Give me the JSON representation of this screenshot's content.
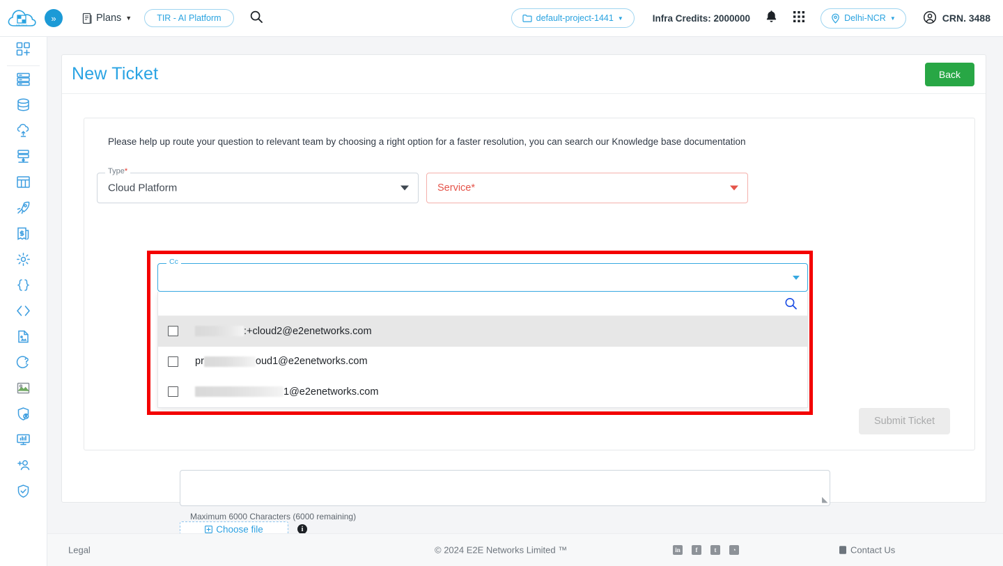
{
  "header": {
    "logo_alt": "E2E Cloud",
    "expand_icon": "chevron-double-right-icon",
    "plans_label": "Plans",
    "tir_label": "TIR - AI Platform",
    "search_icon": "search-icon",
    "project_label": "default-project-1441",
    "infra_credits": "Infra Credits: 2000000",
    "bell_icon": "notification-bell-icon",
    "apps_icon": "apps-grid-icon",
    "region_label": "Delhi-NCR",
    "account_label": "CRN. 3488"
  },
  "sidebar": {
    "items": [
      {
        "icon": "dashboard-add-icon",
        "name": "sidebar-item-dashboard"
      },
      {
        "icon": "server-rack-icon",
        "name": "sidebar-item-compute"
      },
      {
        "icon": "database-icon",
        "name": "sidebar-item-database"
      },
      {
        "icon": "cloud-upload-icon",
        "name": "sidebar-item-cloud"
      },
      {
        "icon": "server-network-icon",
        "name": "sidebar-item-network"
      },
      {
        "icon": "table-grid-icon",
        "name": "sidebar-item-storage"
      },
      {
        "icon": "rocket-icon",
        "name": "sidebar-item-launch"
      },
      {
        "icon": "billing-invoice-icon",
        "name": "sidebar-item-billing"
      },
      {
        "icon": "gear-icon",
        "name": "sidebar-item-settings"
      },
      {
        "icon": "curly-braces-icon",
        "name": "sidebar-item-api"
      },
      {
        "icon": "angle-brackets-icon",
        "name": "sidebar-item-code"
      },
      {
        "icon": "document-image-icon",
        "name": "sidebar-item-docs"
      },
      {
        "icon": "support-question-icon",
        "name": "sidebar-item-support"
      },
      {
        "icon": "image-icon",
        "name": "sidebar-item-images"
      },
      {
        "icon": "shield-user-icon",
        "name": "sidebar-item-iam"
      },
      {
        "icon": "monitor-chart-icon",
        "name": "sidebar-item-monitoring"
      },
      {
        "icon": "add-user-icon",
        "name": "sidebar-item-add-user"
      },
      {
        "icon": "shield-check-icon",
        "name": "sidebar-item-security"
      }
    ]
  },
  "main": {
    "title": "New Ticket",
    "back_label": "Back",
    "helper_text": "Please help up route your question to relevant team by choosing a right option for a faster resolution, you can search our Knowledge base documentation",
    "type_field": {
      "label": "Type",
      "required_mark": "*",
      "value": "Cloud Platform",
      "caret_icon": "chevron-down-icon"
    },
    "service_field": {
      "placeholder": "Service*",
      "caret_icon": "chevron-down-icon"
    },
    "cc_field": {
      "label": "Cc",
      "value": "",
      "caret_icon": "chevron-down-icon",
      "search_placeholder": "",
      "search_value": "",
      "search_icon": "search-icon",
      "options": [
        {
          "prefix": "",
          "redacted_width": 70,
          "suffix": ":+cloud2@e2enetworks.com",
          "selected": true,
          "checked": false
        },
        {
          "prefix": "pr",
          "redacted_width": 74,
          "suffix": "oud1@e2enetworks.com",
          "selected": false,
          "checked": false
        },
        {
          "prefix": "",
          "redacted_width": 127,
          "suffix": "1@e2enetworks.com",
          "selected": false,
          "checked": false
        }
      ]
    },
    "description_field": {
      "value": "",
      "char_note": "Maximum 6000 Characters (6000 remaining)",
      "resize_icon": "resize-grip-icon"
    },
    "choose_file_label": "Choose file",
    "choose_file_icon": "plus-box-icon",
    "info_icon": "info-icon",
    "info_glyph": "i",
    "submit_label": "Submit Ticket"
  },
  "footer": {
    "legal": "Legal",
    "copyright": "© 2024 E2E Networks Limited ™",
    "socials": [
      {
        "name": "linkedin-icon",
        "glyph": "in"
      },
      {
        "name": "facebook-icon",
        "glyph": "f"
      },
      {
        "name": "twitter-icon",
        "glyph": "t"
      },
      {
        "name": "rss-icon",
        "glyph": "◔"
      }
    ],
    "contact_label": "Contact Us",
    "contact_icon": "phone-icon"
  },
  "colors": {
    "accent_blue": "#29a3e3",
    "green": "#28a745",
    "danger_red": "#e5332a",
    "annotation_red": "#f40000"
  }
}
